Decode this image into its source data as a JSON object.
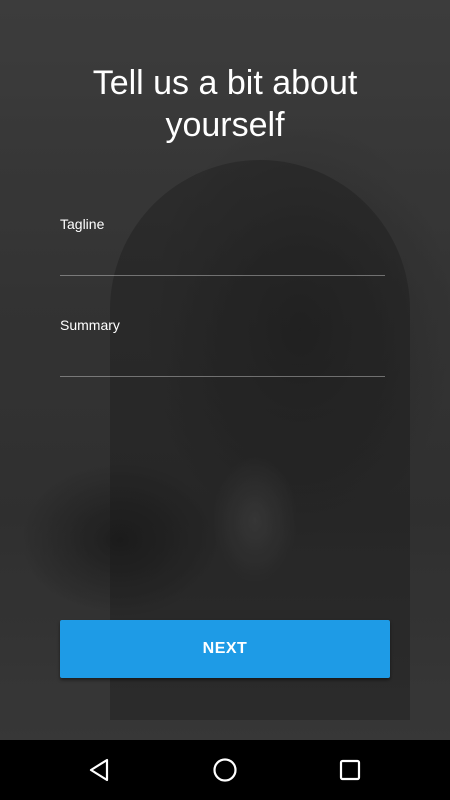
{
  "onboarding": {
    "title": "Tell us a bit about yourself",
    "fields": [
      {
        "label": "Tagline",
        "value": "",
        "placeholder": ""
      },
      {
        "label": "Summary",
        "value": "",
        "placeholder": ""
      }
    ],
    "next_label": "NEXT"
  },
  "system_nav": {
    "icons": [
      "back-icon",
      "home-icon",
      "recent-apps-icon"
    ]
  },
  "colors": {
    "accent": "#1e9be6",
    "text": "#ffffff",
    "navbar": "#000000"
  }
}
